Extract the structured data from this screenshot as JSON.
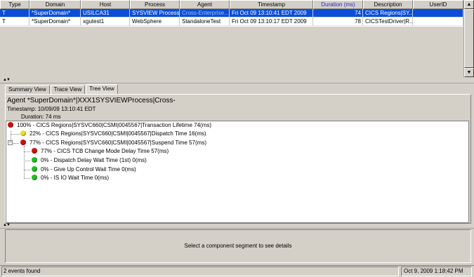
{
  "events_table": {
    "columns": [
      "Type",
      "Domain",
      "Host",
      "Process",
      "Agent",
      "Timestamp",
      "Duration (ms)",
      "Description",
      "UserID"
    ],
    "sorted_column": "Duration (ms)",
    "rows": [
      {
        "type": "T",
        "domain": "*SuperDomain*",
        "host": "USILCA31",
        "process": "SYSVIEW Process",
        "agent": "Cross-Enterprise...",
        "timestamp": "Fri Oct 09 13:10:41 EDT 2009",
        "duration": "74",
        "description": "CICS Regions|SY...",
        "userid": ""
      },
      {
        "type": "T",
        "domain": "*SuperDomain*",
        "host": "xgutest1",
        "process": "WebSphere",
        "agent": "StandaloneTest",
        "timestamp": "Fri Oct 09 13:10:17 EDT 2009",
        "duration": "78",
        "description": "CICSTestDriver|R...",
        "userid": ""
      }
    ]
  },
  "tabs": [
    "Summary View",
    "Trace View",
    "Tree View"
  ],
  "active_tab": "Tree View",
  "tree_view": {
    "agent": "Agent *SuperDomain*|XXX1SYSVIEWProcess|Cross-",
    "timestamp": "Timestamp: 10/09/09 13:10:41 EDT",
    "duration": "Duration: 74 ms",
    "nodes": [
      {
        "label": "100% - CICS Regions|SYSVC660|CSMI|0045567|Transaction Lifetime 74(ms)",
        "status": "red",
        "expander": "-"
      },
      {
        "label": "22% - CICS Regions|SYSVC660|CSMI|0045567|Dispatch Time 16(ms)",
        "status": "yellow"
      },
      {
        "label": "77% - CICS Regions|SYSVC660|CSMI|0045567|Suspend Time 57(ms)",
        "status": "red",
        "expander": "-"
      },
      {
        "label": "77% - CICS TCB Change Mode Delay Time 57(ms)",
        "status": "red"
      },
      {
        "label": "0% - Dispatch Delay Wait Time (1st) 0(ms)",
        "status": "green"
      },
      {
        "label": "0% - Give Up Control Wait Time 0(ms)",
        "status": "green"
      },
      {
        "label": "0% - IS IO Wait Time 0(ms)",
        "status": "green"
      }
    ]
  },
  "details_message": "Select a component segment to see details",
  "status_bar": {
    "events": "2 events found",
    "datetime": "Oct 9, 2009 1:18:42 PM"
  },
  "colors": {
    "selection": "#0a4ed8",
    "status_red": "#d01010",
    "status_yellow": "#f0e020",
    "status_green": "#20c020",
    "sorted_header": "#2323c8"
  },
  "icons": {
    "scroll_up": "triangle-up-icon",
    "scroll_down": "triangle-down-icon",
    "splitter": "split-arrows-icon",
    "tree_collapse": "minus-expander-icon"
  }
}
